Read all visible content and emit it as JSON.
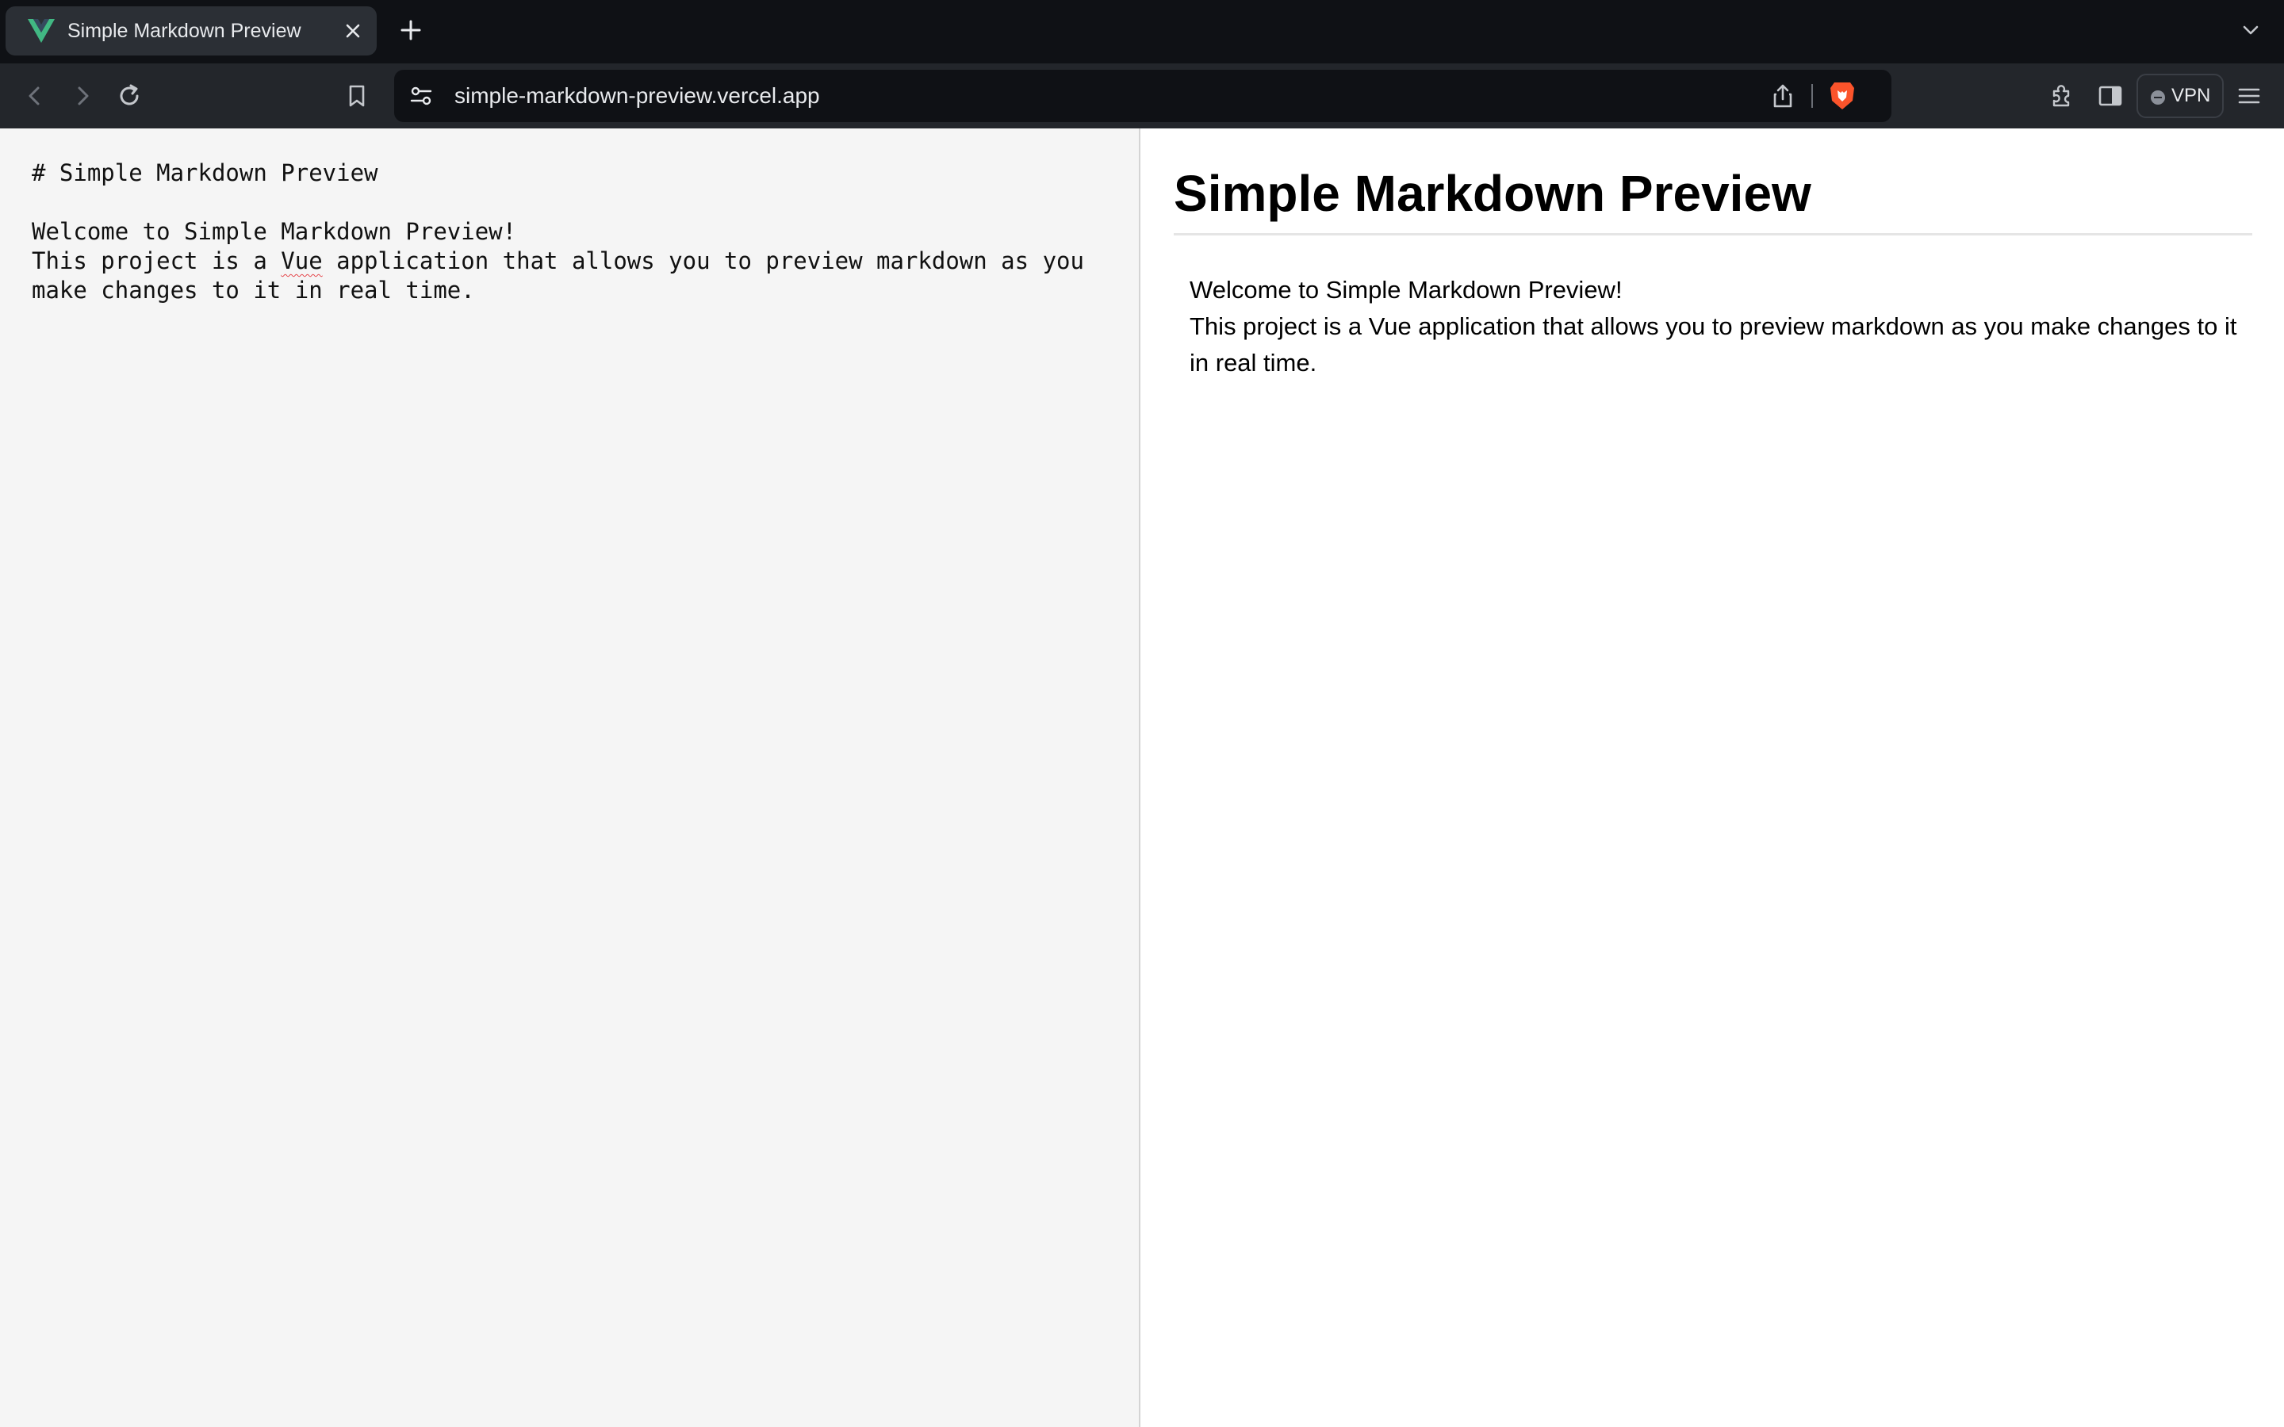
{
  "browser": {
    "tab": {
      "title": "Simple Markdown Preview"
    },
    "url": "simple-markdown-preview.vercel.app",
    "vpn_label": "VPN"
  },
  "editor": {
    "lines": [
      "# Simple Markdown Preview",
      "",
      "Welcome to Simple Markdown Preview!",
      "This project is a ",
      "Vue",
      " application that allows you to preview markdown as you make changes to it in real time."
    ]
  },
  "preview": {
    "heading": "Simple Markdown Preview",
    "paragraph_line1": "Welcome to Simple Markdown Preview!",
    "paragraph_line2": "This project is a Vue application that allows you to preview markdown as you make changes to it in real time."
  },
  "colors": {
    "accent_vue": "#41b883",
    "brave": "#fb542b"
  },
  "icons": [
    "vue-logo-icon",
    "close-icon",
    "plus-icon",
    "chevron-down-icon",
    "back-icon",
    "forward-icon",
    "reload-icon",
    "bookmark-icon",
    "site-info-icon",
    "share-icon",
    "brave-shield-icon",
    "extensions-icon",
    "sidebar-icon",
    "menu-icon"
  ]
}
